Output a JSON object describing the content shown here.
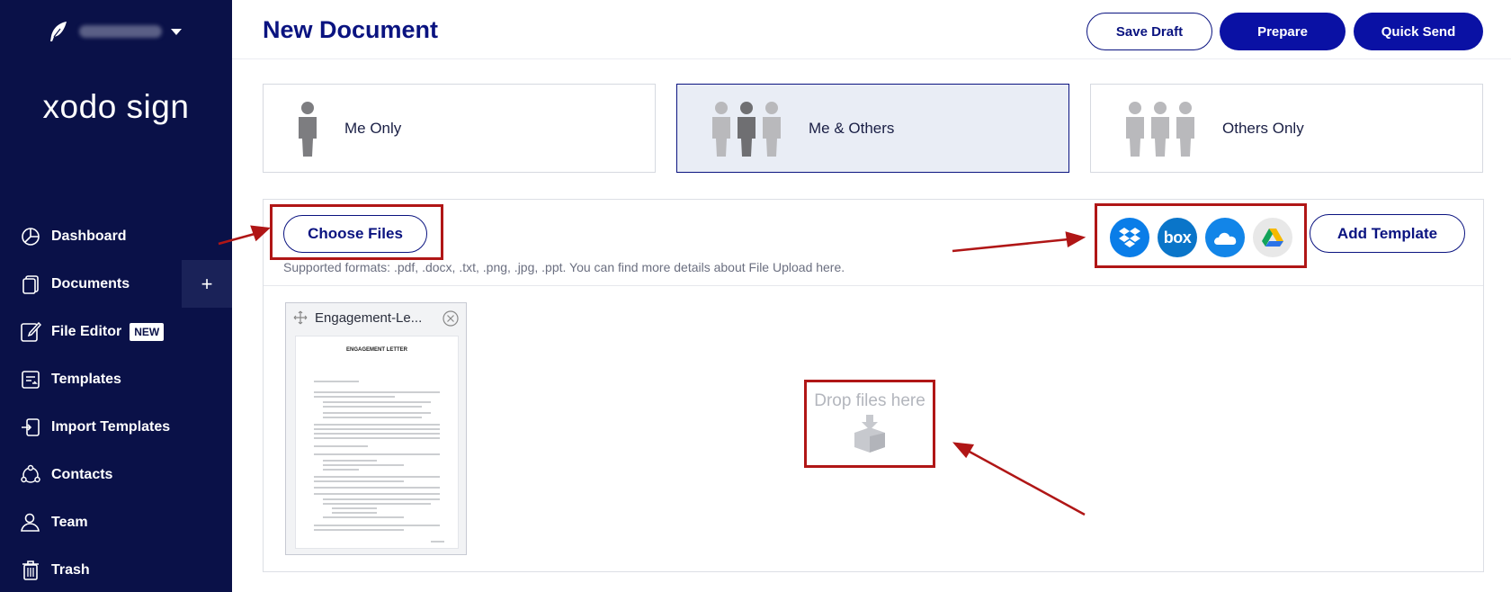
{
  "sidebar": {
    "brand": "xodo sign",
    "items": [
      {
        "label": "Dashboard",
        "icon": "dashboard-icon"
      },
      {
        "label": "Documents",
        "icon": "documents-icon"
      },
      {
        "label": "File Editor",
        "icon": "file-editor-icon",
        "badge": "NEW"
      },
      {
        "label": "Templates",
        "icon": "templates-icon"
      },
      {
        "label": "Import Templates",
        "icon": "import-templates-icon"
      },
      {
        "label": "Contacts",
        "icon": "contacts-icon"
      },
      {
        "label": "Team",
        "icon": "team-icon"
      },
      {
        "label": "Trash",
        "icon": "trash-icon"
      }
    ],
    "plus_label": "+"
  },
  "header": {
    "title": "New Document",
    "save_draft": "Save Draft",
    "prepare": "Prepare",
    "quick_send": "Quick Send"
  },
  "signers": {
    "options": [
      {
        "label": "Me Only",
        "selected": false
      },
      {
        "label": "Me & Others",
        "selected": true
      },
      {
        "label": "Others Only",
        "selected": false
      }
    ]
  },
  "upload": {
    "choose_files": "Choose Files",
    "formats": "Supported formats: .pdf, .docx, .txt, .png, .jpg, .ppt. You can find more details about File Upload here.",
    "add_template": "Add Template",
    "cloud_sources": [
      {
        "name": "dropbox-icon",
        "color": "#0a7de8"
      },
      {
        "name": "box-icon",
        "color": "#0a75c9",
        "text": "box"
      },
      {
        "name": "onedrive-icon",
        "color": "#1285e8"
      },
      {
        "name": "google-drive-icon",
        "color": "#e8e8e8"
      }
    ],
    "drop_text": "Drop files here",
    "file": {
      "name": "Engagement-Le...",
      "page_title": "ENGAGEMENT LETTER"
    }
  },
  "colors": {
    "sidebar_bg": "#0a1148",
    "primary": "#0a11a4",
    "title": "#0a1380",
    "annotation": "#b01616"
  }
}
